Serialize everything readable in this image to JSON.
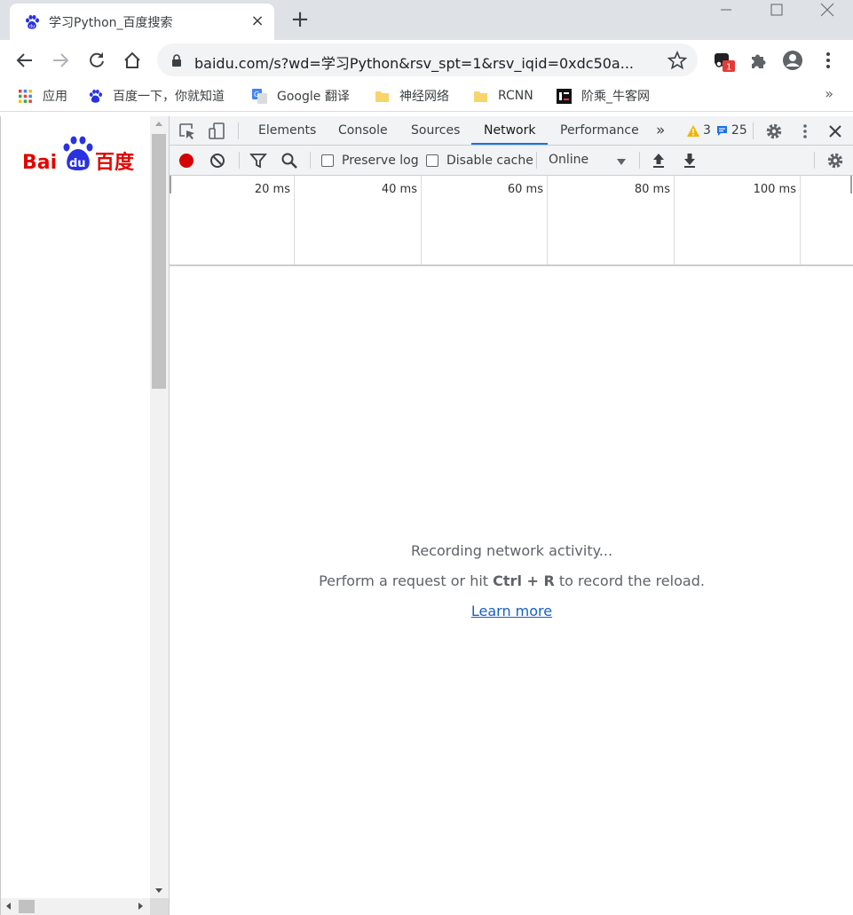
{
  "browser": {
    "tab": {
      "title": "学习Python_百度搜索",
      "favicon": "baidu-paw-icon"
    },
    "url": "baidu.com/s?wd=学习Python&rsv_spt=1&rsv_iqid=0xdc50a...",
    "extension_badge": "1"
  },
  "bookmarks": [
    {
      "label": "应用",
      "icon": "apps-grid-icon"
    },
    {
      "label": "百度一下，你就知道",
      "icon": "baidu-paw-icon"
    },
    {
      "label": "Google 翻译",
      "icon": "google-translate-icon"
    },
    {
      "label": "神经网络",
      "icon": "folder-icon"
    },
    {
      "label": "RCNN",
      "icon": "folder-icon"
    },
    {
      "label": "阶乘_牛客网",
      "icon": "nowcoder-icon"
    }
  ],
  "page": {
    "logo_text_bai": "Bai",
    "logo_text_du": "du",
    "logo_text_cn": "百度"
  },
  "devtools": {
    "tabs": [
      "Elements",
      "Console",
      "Sources",
      "Network",
      "Performance"
    ],
    "active_tab": "Network",
    "warnings_count": "3",
    "messages_count": "25",
    "preserve_log_label": "Preserve log",
    "disable_cache_label": "Disable cache",
    "throttling": "Online",
    "timeline_labels": [
      "20 ms",
      "40 ms",
      "60 ms",
      "80 ms",
      "100 ms"
    ],
    "empty_state": {
      "title": "Recording network activity...",
      "hint_prefix": "Perform a request or hit",
      "hint_key": "Ctrl + R",
      "hint_suffix": "to record the reload.",
      "learn_more": "Learn more"
    }
  },
  "colors": {
    "record_red": "#d50000",
    "baidu_red": "#e10601",
    "baidu_blue": "#2932e1",
    "link_blue": "#1a5fc7",
    "active_tab_underline": "#1a73e8",
    "warning_yellow": "#f4b400",
    "message_blue": "#1a73e8"
  }
}
